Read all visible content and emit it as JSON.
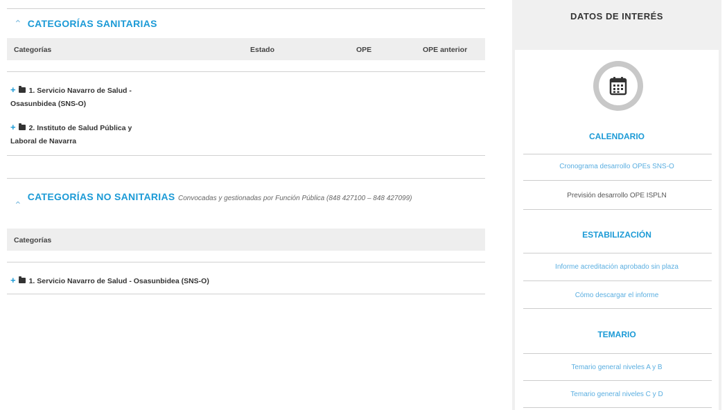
{
  "sanitarias": {
    "title": "CATEGORÍAS SANITARIAS",
    "columns": [
      "Categorías",
      "Estado",
      "OPE",
      "OPE anterior"
    ],
    "items": [
      {
        "line1": "1. Servicio Navarro de Salud -",
        "line2": "Osasunbidea (SNS-O)"
      },
      {
        "line1": "2. Instituto de Salud Pública y",
        "line2": "Laboral de Navarra"
      }
    ]
  },
  "no_sanitarias": {
    "title": "CATEGORÍAS NO SANITARIAS",
    "note": "Convocadas y gestionadas por Función Pública (848 427100 – 848 427099)",
    "columns": [
      "Categorías"
    ],
    "items": [
      {
        "line1": "1. Servicio Navarro de Salud - Osasunbidea (SNS-O)"
      }
    ]
  },
  "sidebar": {
    "title": "DATOS DE INTERÉS",
    "calendar_heading": "CALENDARIO",
    "calendar_link_1": "Cronograma desarrollo OPEs SNS-O",
    "calendar_text_2": "Previsión desarrollo OPE ISPLN",
    "stab_heading": "ESTABILIZACIÓN",
    "stab_link_1": "Informe acreditación aprobado sin plaza",
    "stab_link_2": "Cómo descargar el informe",
    "temario_heading": "TEMARIO",
    "temario_link_1": "Temario general niveles A y B",
    "temario_link_2": "Temario general niveles C y D"
  },
  "icons": {
    "collapse": "chevron-up-icon",
    "expand": "plus-icon",
    "folder": "folder-icon",
    "calendar": "calendar-icon"
  },
  "colors": {
    "accent": "#1b9ad6",
    "link": "#5aaee0"
  }
}
